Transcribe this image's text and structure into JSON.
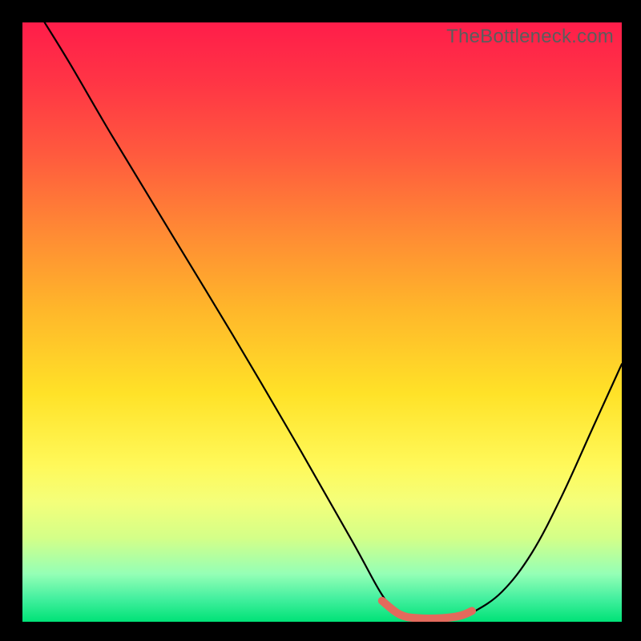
{
  "watermark": "TheBottleneck.com",
  "chart_data": {
    "type": "line",
    "title": "",
    "xlabel": "",
    "ylabel": "",
    "xlim": [
      0,
      100
    ],
    "ylim": [
      0,
      100
    ],
    "series": [
      {
        "name": "curve",
        "x": [
          3.7,
          8,
          15,
          25,
          35,
          45,
          55,
          60,
          63,
          66,
          72,
          75,
          80,
          85,
          90,
          95,
          100
        ],
        "y": [
          100,
          93,
          81,
          64.5,
          48,
          31,
          13.5,
          4.5,
          1.2,
          0.4,
          0.5,
          1.5,
          5,
          11.5,
          21,
          32,
          43
        ],
        "color": "#000000"
      },
      {
        "name": "highlight",
        "x": [
          60,
          63,
          66,
          70,
          73,
          75
        ],
        "y": [
          3.5,
          1.2,
          0.6,
          0.6,
          1.0,
          1.8
        ],
        "color": "#e36a5c"
      }
    ],
    "background_gradient": {
      "top": "#ff1d4a",
      "mid": "#ffe228",
      "bottom": "#00e277"
    }
  }
}
